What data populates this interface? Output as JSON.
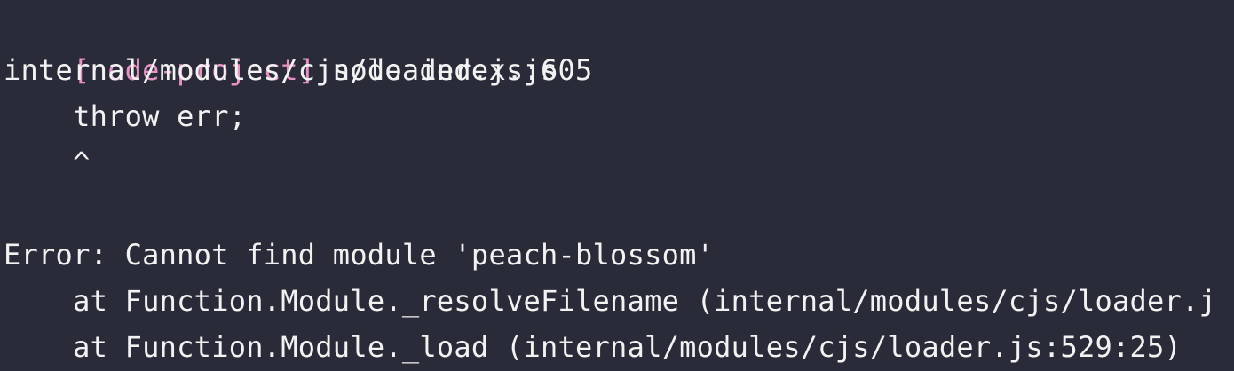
{
  "terminal": {
    "prompt": "[node-project]",
    "command": " node index.js",
    "lines": [
      "internal/modules/cjs/loader.js:605",
      "    throw err;",
      "    ^",
      "",
      "Error: Cannot find module 'peach-blossom'",
      "    at Function.Module._resolveFilename (internal/modules/cjs/loader.j",
      "    at Function.Module._load (internal/modules/cjs/loader.js:529:25)"
    ]
  },
  "colors": {
    "background": "#2a2b38",
    "text": "#f2f2f2",
    "prompt": "#e891c3"
  }
}
